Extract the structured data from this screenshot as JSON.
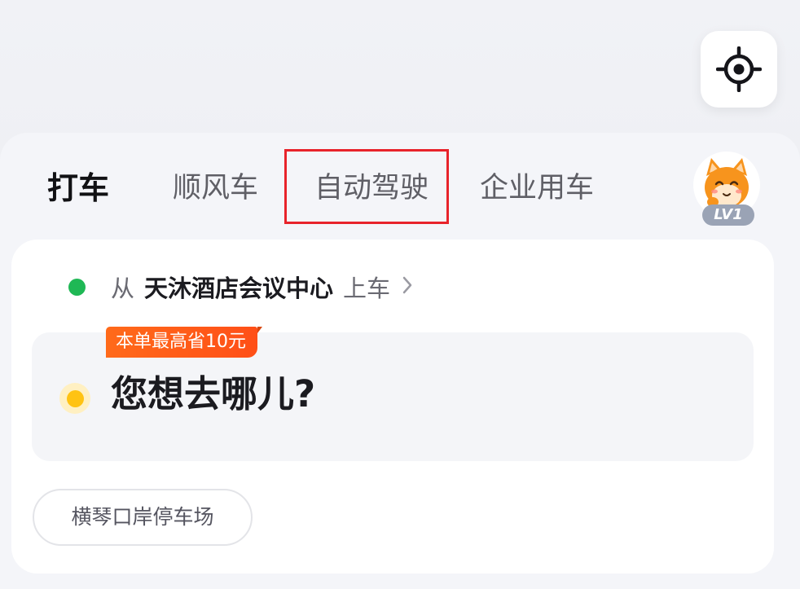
{
  "tabs": {
    "taxi": "打车",
    "carpool": "顺风车",
    "autonomous": "自动驾驶",
    "enterprise": "企业用车"
  },
  "profile": {
    "level": "LV1"
  },
  "pickup": {
    "prefix": "从",
    "location": "天沐酒店会议中心",
    "suffix": "上车",
    "chevron": "›"
  },
  "destination": {
    "promo": "本单最高省10元",
    "placeholder": "您想去哪儿?"
  },
  "suggestions": [
    {
      "label": "横琴口岸停车场"
    }
  ],
  "icons": {
    "locate": "crosshair-locate-icon",
    "avatar": "orange-cat-mascot-icon"
  },
  "colors": {
    "accent_yellow": "#ffd21f",
    "pickup_green": "#1fb855",
    "promo_orange": "#ff5a17",
    "highlight_red": "#e8232b"
  }
}
